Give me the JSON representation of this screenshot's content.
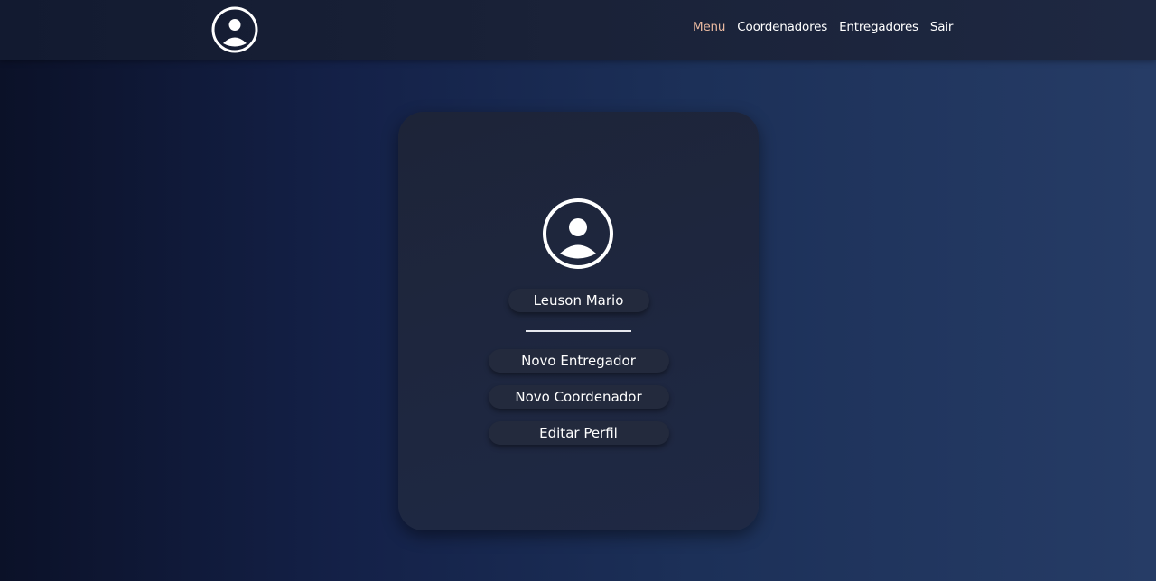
{
  "nav": {
    "logo_icon": "user-circle-icon",
    "links": [
      {
        "label": "Menu",
        "active": true
      },
      {
        "label": "Coordenadores",
        "active": false
      },
      {
        "label": "Entregadores",
        "active": false
      },
      {
        "label": "Sair",
        "active": false
      }
    ]
  },
  "profile": {
    "avatar_icon": "user-circle-icon",
    "name": "Leuson Mario"
  },
  "actions": {
    "new_courier": "Novo Entregador",
    "new_coordinator": "Novo Coordenador",
    "edit_profile": "Editar Perfil"
  },
  "colors": {
    "active_link": "#e9b9a0",
    "text": "#ffffff",
    "card_bg": "#1e2740",
    "pill_bg": "#232a3d"
  }
}
